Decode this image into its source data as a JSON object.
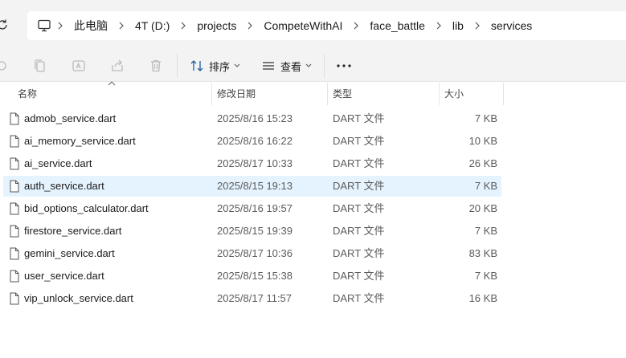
{
  "address": {
    "segments": [
      "此电脑",
      "4T (D:)",
      "projects",
      "CompeteWithAI",
      "face_battle",
      "lib",
      "services"
    ]
  },
  "toolbar": {
    "sort_label": "排序",
    "view_label": "查看"
  },
  "columns": {
    "name": "名称",
    "date": "修改日期",
    "type": "类型",
    "size": "大小"
  },
  "files": [
    {
      "name": "admob_service.dart",
      "date": "2025/8/16 15:23",
      "type": "DART 文件",
      "size": "7 KB"
    },
    {
      "name": "ai_memory_service.dart",
      "date": "2025/8/16 16:22",
      "type": "DART 文件",
      "size": "10 KB"
    },
    {
      "name": "ai_service.dart",
      "date": "2025/8/17 10:33",
      "type": "DART 文件",
      "size": "26 KB"
    },
    {
      "name": "auth_service.dart",
      "date": "2025/8/15 19:13",
      "type": "DART 文件",
      "size": "7 KB",
      "selected": true
    },
    {
      "name": "bid_options_calculator.dart",
      "date": "2025/8/16 19:57",
      "type": "DART 文件",
      "size": "20 KB"
    },
    {
      "name": "firestore_service.dart",
      "date": "2025/8/15 19:39",
      "type": "DART 文件",
      "size": "7 KB"
    },
    {
      "name": "gemini_service.dart",
      "date": "2025/8/17 10:36",
      "type": "DART 文件",
      "size": "83 KB"
    },
    {
      "name": "user_service.dart",
      "date": "2025/8/15 15:38",
      "type": "DART 文件",
      "size": "7 KB"
    },
    {
      "name": "vip_unlock_service.dart",
      "date": "2025/8/17 11:57",
      "type": "DART 文件",
      "size": "16 KB"
    }
  ],
  "colors": {
    "chrome_bg": "#f3f3f3",
    "selection_bg": "#e5f3fe",
    "divider": "#e5e5e5"
  }
}
